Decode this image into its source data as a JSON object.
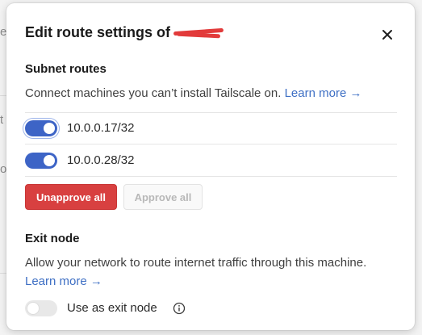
{
  "background": {
    "fragments": [
      "er",
      "t",
      "o"
    ]
  },
  "dialog": {
    "title": "Edit route settings of",
    "close_label": "×"
  },
  "subnet": {
    "heading": "Subnet routes",
    "description": "Connect machines you can’t install Tailscale on.",
    "learn_more": "Learn more →",
    "routes": [
      {
        "label": "10.0.0.17/32",
        "enabled": true
      },
      {
        "label": "10.0.0.28/32",
        "enabled": true
      }
    ],
    "unapprove_label": "Unapprove all",
    "approve_label": "Approve all"
  },
  "exit_node": {
    "heading": "Exit node",
    "description": "Allow your network to route internet traffic through this machine.",
    "learn_more": "Learn more →",
    "toggle_label": "Use as exit node",
    "enabled": false
  },
  "colors": {
    "accent": "#3d64c6",
    "danger": "#d84040",
    "link": "#3e6fc4",
    "redaction": "#e23b3b"
  },
  "icons": [
    "close-icon",
    "info-icon"
  ]
}
